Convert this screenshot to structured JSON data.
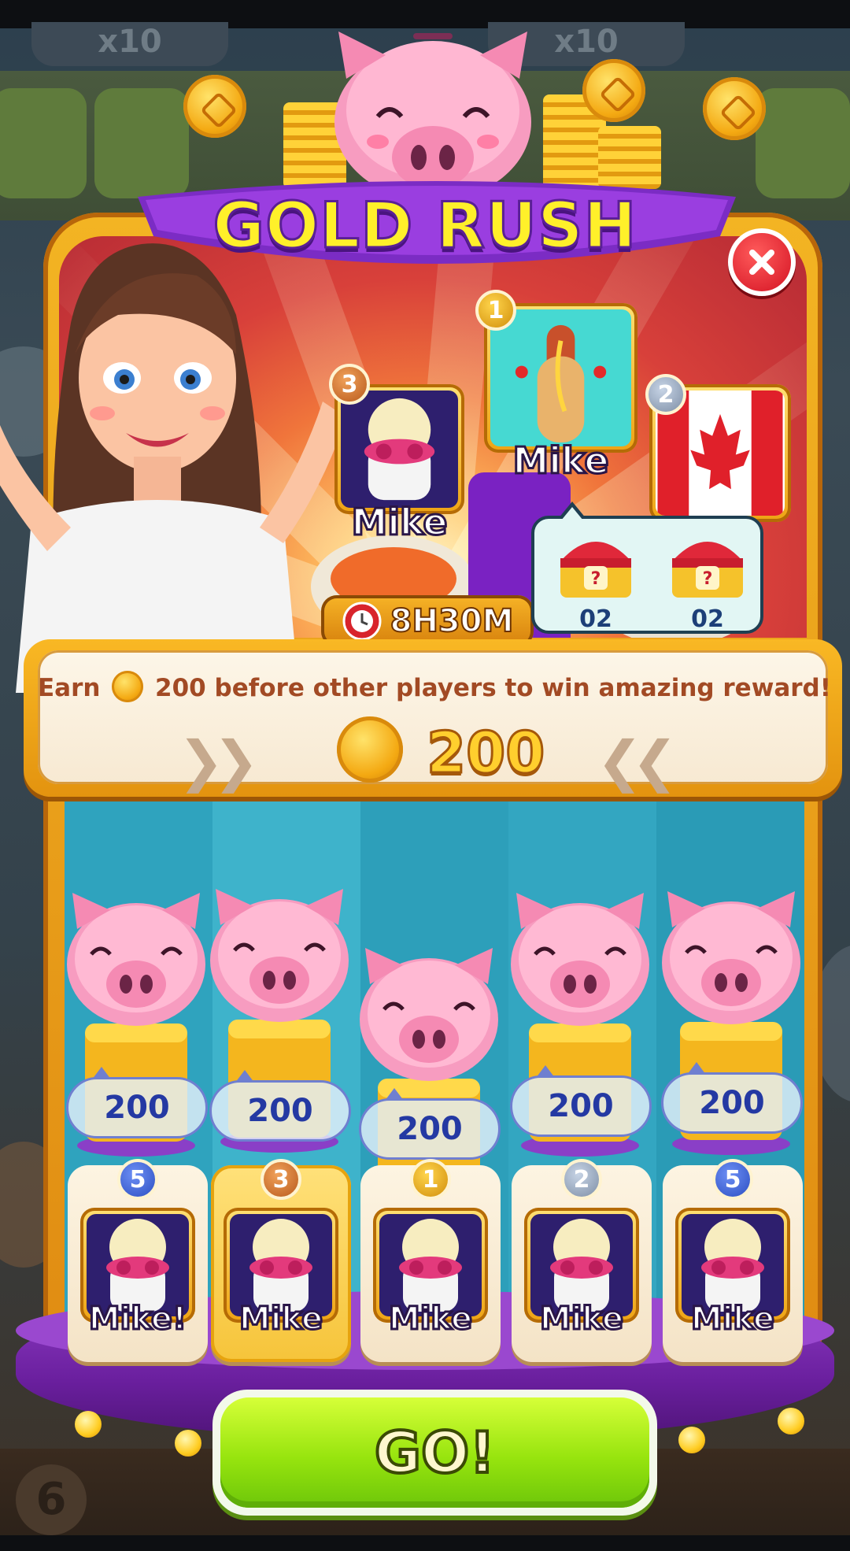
{
  "event": {
    "title": "GOLD RUSH",
    "timer": "8H30M",
    "goal_prefix": "Earn",
    "goal_suffix": "200 before other players to win amazing reward!",
    "goal_amount": "200"
  },
  "podium": [
    {
      "rank": "1",
      "name": "Mike",
      "avatar": "hotdog-avatar"
    },
    {
      "rank": "2",
      "name": "",
      "avatar": "canada-flag-avatar"
    },
    {
      "rank": "3",
      "name": "Mike",
      "avatar": "sheep-avatar"
    }
  ],
  "rewards": [
    {
      "icon": "mystery-chest-icon",
      "count": "02"
    },
    {
      "icon": "mystery-chest-icon",
      "count": "02"
    }
  ],
  "lanes": [
    {
      "score": "200",
      "rank": "5",
      "name": "Mike!"
    },
    {
      "score": "200",
      "rank": "3",
      "name": "Mike"
    },
    {
      "score": "200",
      "rank": "1",
      "name": "Mike"
    },
    {
      "score": "200",
      "rank": "2",
      "name": "Mike"
    },
    {
      "score": "200",
      "rank": "5",
      "name": "Mike"
    }
  ],
  "background": {
    "pill_left": "x10",
    "pill_right": "x10",
    "floor_number": "6"
  },
  "buttons": {
    "go_label": "GO!"
  },
  "colors": {
    "title_yellow": "#fff02a",
    "ribbon_purple": "#7b2cc4",
    "frame_gold": "#f3b423",
    "go_green": "#97e40e",
    "close_red": "#d41323"
  }
}
